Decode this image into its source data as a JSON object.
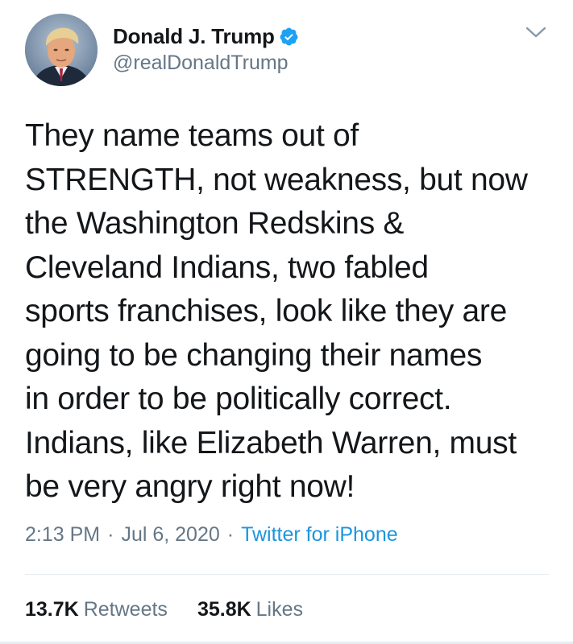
{
  "author": {
    "display_name": "Donald J. Trump",
    "handle": "@realDonaldTrump",
    "verified": true,
    "avatar_icon": "profile-photo",
    "verified_color": "#1da1f2"
  },
  "menu_icon": "chevron-down-icon",
  "tweet": {
    "text": "They name teams out of\nSTRENGTH, not weakness, but now\nthe Washington Redskins &\nCleveland Indians, two fabled\nsports franchises, look like they are\ngoing to be changing their names\nin order to be politically correct.\nIndians, like Elizabeth Warren, must\nbe very angry right now!"
  },
  "meta": {
    "time": "2:13 PM",
    "separator": "·",
    "date": "Jul 6, 2020",
    "source": "Twitter for iPhone",
    "source_color": "#1b95e0"
  },
  "stats": {
    "retweets_count": "13.7K",
    "retweets_label": "Retweets",
    "likes_count": "35.8K",
    "likes_label": "Likes"
  },
  "colors": {
    "text": "#14171a",
    "secondary": "#657786",
    "divider": "#e6ecf0"
  }
}
